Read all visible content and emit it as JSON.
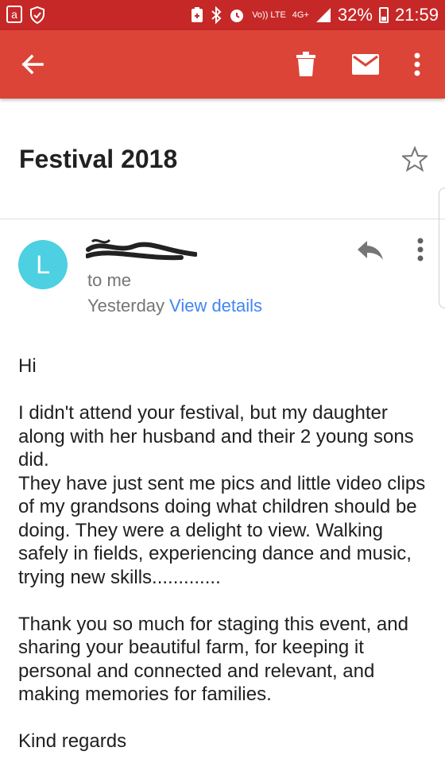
{
  "status_bar": {
    "volte": "Vo)) LTE",
    "network": "4G+",
    "battery": "32%",
    "time": "21:59"
  },
  "app_bar": {
    "back_icon": "arrow-left-icon",
    "delete_icon": "trash-icon",
    "mark_unread_icon": "mail-icon",
    "more_icon": "more-vert-icon"
  },
  "email": {
    "subject": "Festival 2018",
    "avatar_letter": "L",
    "recipient": "to me",
    "date": "Yesterday",
    "details_link": "View details",
    "greeting": "Hi",
    "paragraph1": "I didn't attend your festival, but my daughter along with her husband and their 2 young sons did.",
    "paragraph2": "They have just sent me pics and little video clips of my grandsons doing what children should be doing. They were a delight to view. Walking safely in fields, experiencing dance and music, trying new skills.............",
    "paragraph3": "Thank you so much for staging this event, and sharing your beautiful farm, for keeping it personal and connected and relevant, and making memories for families.",
    "signoff": "Kind regards"
  },
  "colors": {
    "status_bar": "#c62828",
    "app_bar": "#db4437",
    "avatar": "#4dd0e1",
    "link": "#4285f4"
  }
}
